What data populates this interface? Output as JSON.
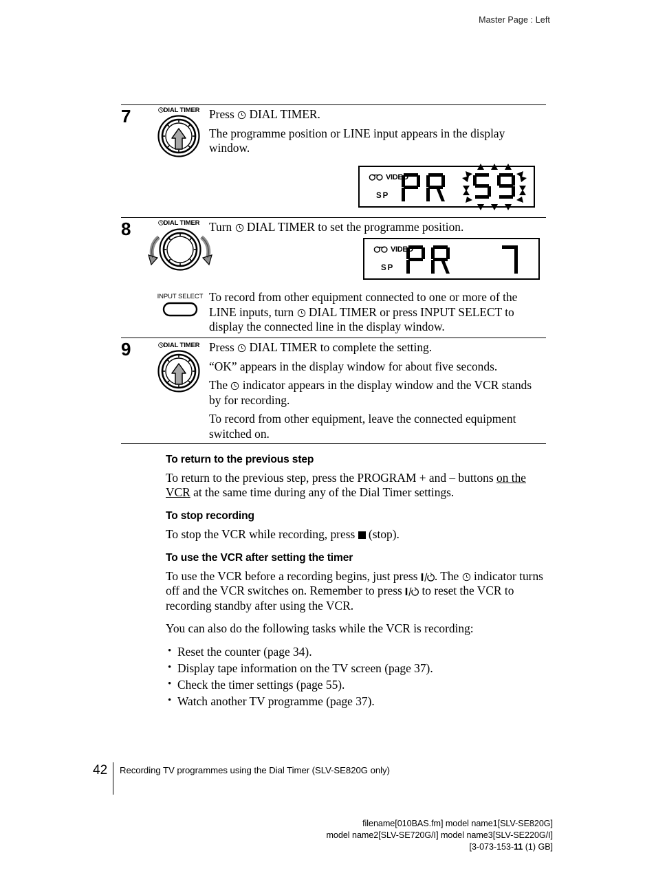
{
  "header": {
    "master_page": "Master Page : Left"
  },
  "steps": [
    {
      "number": "7",
      "dial_label": "DIAL TIMER",
      "dial_icon": "dial-knob-press-icon",
      "lines": [
        "Press ⊗ DIAL TIMER.",
        "The programme position or LINE input appears in the display window."
      ],
      "line1_pre": "Press",
      "line1_post": "DIAL TIMER.",
      "line2": "The programme position or LINE input appears in the display window.",
      "display": {
        "video_label": "VIDEO",
        "tape_icon": "cassette-tape-icon",
        "speed_label": "SP",
        "left_text": "PR",
        "right_text": "59",
        "flashing": true
      }
    },
    {
      "number": "8",
      "dial_label": "DIAL TIMER",
      "dial_icon": "dial-knob-turn-icon",
      "line1_pre": "Turn",
      "line1_post": "DIAL TIMER to set the programme position.",
      "input_select_label": "INPUT SELECT",
      "para2_a": "To record from other equipment connected to one or more of the LINE inputs, turn",
      "para2_b": "DIAL TIMER or press INPUT SELECT to display the connected line in the display window.",
      "display": {
        "video_label": "VIDEO",
        "tape_icon": "cassette-tape-icon",
        "speed_label": "SP",
        "left_text": "PR",
        "right_text": "7",
        "flashing": false
      }
    },
    {
      "number": "9",
      "dial_label": "DIAL TIMER",
      "dial_icon": "dial-knob-press-icon",
      "line1_pre": "Press",
      "line1_post": "DIAL TIMER to complete the setting.",
      "line2": "“OK” appears in the display window for about five seconds.",
      "line3_pre": "The",
      "line3_post": "indicator appears in the display window and the VCR stands by for recording.",
      "line4": "To record from other equipment, leave the connected equipment switched on."
    }
  ],
  "sections": [
    {
      "heading": "To return to the previous step",
      "body_a": "To return to the previous step, press the PROGRAM + and – buttons ",
      "body_underline": "on the VCR",
      "body_b": " at the same time during any of the Dial Timer settings."
    },
    {
      "heading": "To stop recording",
      "body_a": "To stop the VCR while recording, press ",
      "body_b": " (stop).",
      "icon": "stop-square-icon"
    },
    {
      "heading": "To use the VCR after setting the timer",
      "p1_a": "To use the VCR before a recording begins, just press ",
      "p1_b": ". The",
      "p1_c": "indicator turns off and the VCR switches on.  Remember to press ",
      "p1_d": " to reset the VCR to recording standby after using the VCR.",
      "p2": "You can also do the following tasks while the VCR is recording:",
      "bullets": [
        "Reset the counter (page 34).",
        "Display tape information on the TV screen (page 37).",
        "Check the timer settings (page 55).",
        "Watch another TV programme (page 37)."
      ]
    }
  ],
  "footer": {
    "page_number": "42",
    "running_title": "Recording TV programmes using the Dial Timer (SLV-SE820G only)",
    "colophon_line1": "filename[010BAS.fm] model name1[SLV-SE820G]",
    "colophon_line2": "model name2[SLV-SE720G/I] model name3[SLV-SE220G/I]",
    "colophon_line3_pre": "[3-073-153-",
    "colophon_line3_bold": "11",
    "colophon_line3_post": " (1) GB]"
  },
  "colors": {
    "ink": "#000000",
    "paper": "#ffffff",
    "dial_fill": "#a8a8a8"
  }
}
